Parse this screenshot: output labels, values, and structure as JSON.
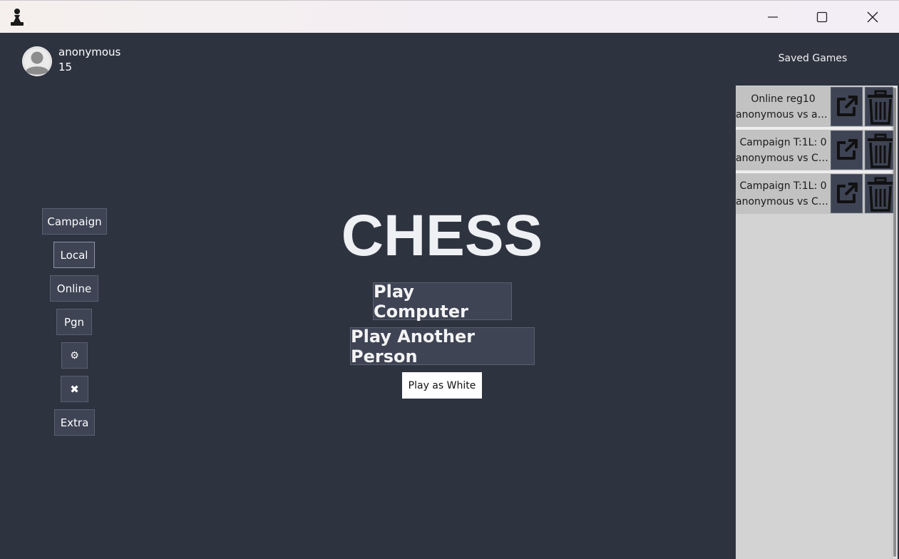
{
  "window": {
    "app_icon": "pawn-icon",
    "minimize_icon": "minimize-icon",
    "maximize_icon": "maximize-icon",
    "close_icon": "close-icon"
  },
  "user": {
    "name": "anonymous",
    "score": "15",
    "avatar_icon": "user-avatar-icon"
  },
  "sidebar": {
    "items": [
      {
        "label": "Campaign"
      },
      {
        "label": "Local"
      },
      {
        "label": "Online"
      },
      {
        "label": "Pgn"
      },
      {
        "label": "⚙"
      },
      {
        "label": "✖"
      },
      {
        "label": "Extra"
      }
    ]
  },
  "main": {
    "title": "CHESS",
    "play_computer": "Play Computer",
    "play_person": "Play Another Person",
    "play_as": "Play as White"
  },
  "saved": {
    "title": "Saved Games",
    "games": [
      {
        "name": "Online reg10",
        "players": "anonymous vs an..."
      },
      {
        "name": "Campaign T:1L: 0",
        "players": "anonymous vs Co..."
      },
      {
        "name": "Campaign T:1L: 0",
        "players": "anonymous vs Co..."
      }
    ]
  },
  "colors": {
    "background": "#2e3340",
    "button": "#3e4454",
    "panel": "#d3d3d3"
  }
}
